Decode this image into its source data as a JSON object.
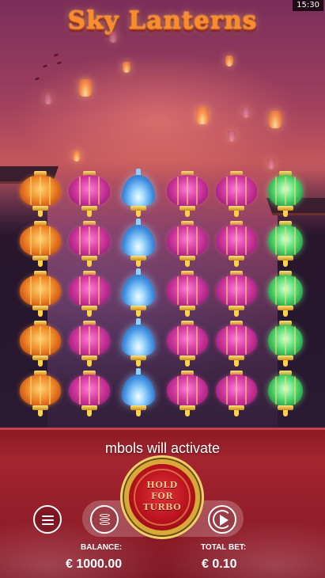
{
  "status_bar": {
    "time": "15:30"
  },
  "game": {
    "title": "Sky Lanterns"
  },
  "reels": [
    [
      "orange",
      "orange",
      "orange",
      "orange",
      "orange"
    ],
    [
      "magenta",
      "magenta",
      "magenta",
      "magenta",
      "magenta"
    ],
    [
      "blue",
      "blue",
      "blue",
      "blue",
      "blue"
    ],
    [
      "magenta",
      "magenta",
      "magenta",
      "magenta",
      "magenta"
    ],
    [
      "magenta",
      "magenta",
      "magenta",
      "magenta",
      "magenta"
    ],
    [
      "green",
      "green",
      "green",
      "green",
      "green"
    ]
  ],
  "message": "mbols will activate",
  "controls": {
    "menu_icon": "hamburger-menu-icon",
    "coins_icon": "coin-stack-icon",
    "autoplay_icon": "autoplay-icon",
    "spin_label_lines": [
      "HOLD",
      "FOR",
      "TURBO"
    ]
  },
  "balance": {
    "label": "BALANCE:",
    "value": "€ 1000.00"
  },
  "total_bet": {
    "label": "TOTAL BET:",
    "value": "€ 0.10"
  },
  "colors": {
    "orange": "#f08a2a",
    "magenta": "#d23aa0",
    "blue": "#3f8fe0",
    "green": "#5ee07a",
    "panel": "#9a202c",
    "spin_rim": "#d8a838"
  }
}
